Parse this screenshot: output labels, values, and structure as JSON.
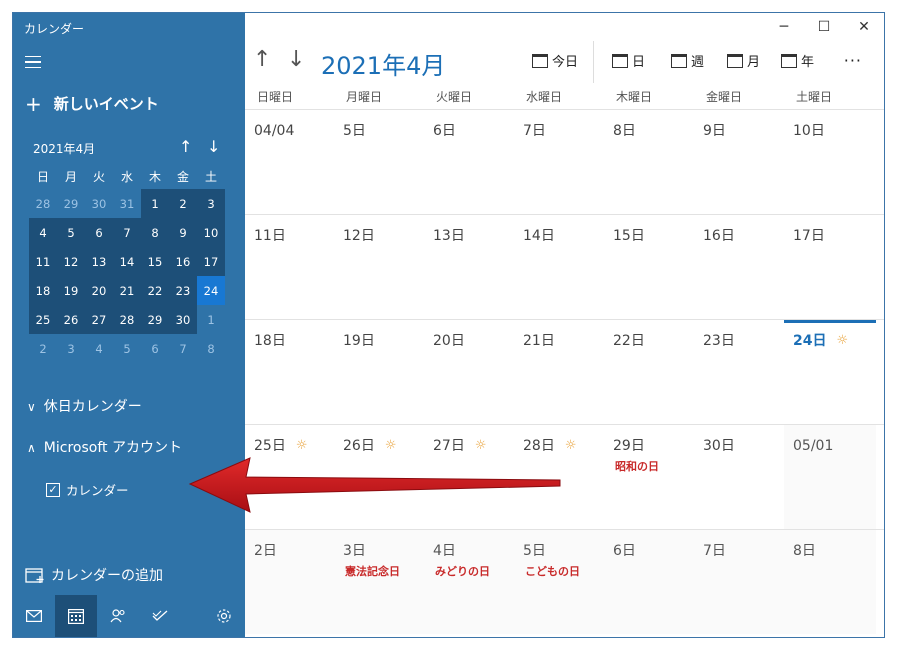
{
  "app": {
    "title": "カレンダー"
  },
  "sidebar": {
    "new_event": "新しいイベント",
    "mini_calendar": {
      "title": "2021年4月",
      "weekdays": [
        "日",
        "月",
        "火",
        "水",
        "木",
        "金",
        "土"
      ],
      "weeks": [
        [
          "28",
          "29",
          "30",
          "31",
          "1",
          "2",
          "3"
        ],
        [
          "4",
          "5",
          "6",
          "7",
          "8",
          "9",
          "10"
        ],
        [
          "11",
          "12",
          "13",
          "14",
          "15",
          "16",
          "17"
        ],
        [
          "18",
          "19",
          "20",
          "21",
          "22",
          "23",
          "24"
        ],
        [
          "25",
          "26",
          "27",
          "28",
          "29",
          "30",
          "1"
        ],
        [
          "2",
          "3",
          "4",
          "5",
          "6",
          "7",
          "8"
        ]
      ],
      "today": "24"
    },
    "holiday_calendar": "休日カレンダー",
    "ms_account": "Microsoft アカウント",
    "calendar_item": "カレンダー",
    "add_calendar": "カレンダーの追加"
  },
  "main": {
    "month_title": "2021年4月",
    "toolbar": {
      "today": "今日",
      "day": "日",
      "week": "週",
      "month": "月",
      "year": "年"
    },
    "weekdays": [
      "日曜日",
      "月曜日",
      "火曜日",
      "水曜日",
      "木曜日",
      "金曜日",
      "土曜日"
    ],
    "weeks": [
      [
        {
          "label": "04/04"
        },
        {
          "label": "5日"
        },
        {
          "label": "6日"
        },
        {
          "label": "7日"
        },
        {
          "label": "8日"
        },
        {
          "label": "9日"
        },
        {
          "label": "10日"
        }
      ],
      [
        {
          "label": "11日"
        },
        {
          "label": "12日"
        },
        {
          "label": "13日"
        },
        {
          "label": "14日"
        },
        {
          "label": "15日"
        },
        {
          "label": "16日"
        },
        {
          "label": "17日"
        }
      ],
      [
        {
          "label": "18日"
        },
        {
          "label": "19日"
        },
        {
          "label": "20日"
        },
        {
          "label": "21日"
        },
        {
          "label": "22日"
        },
        {
          "label": "23日"
        },
        {
          "label": "24日",
          "today": true,
          "sun": true
        }
      ],
      [
        {
          "label": "25日",
          "sun": true
        },
        {
          "label": "26日",
          "sun": true
        },
        {
          "label": "27日",
          "sun": true
        },
        {
          "label": "28日",
          "sun": true
        },
        {
          "label": "29日",
          "holiday": "昭和の日"
        },
        {
          "label": "30日"
        },
        {
          "label": "05/01",
          "out": true
        }
      ],
      [
        {
          "label": "2日",
          "out": true
        },
        {
          "label": "3日",
          "out": true,
          "holiday": "憲法記念日"
        },
        {
          "label": "4日",
          "out": true,
          "holiday": "みどりの日"
        },
        {
          "label": "5日",
          "out": true,
          "holiday": "こどもの日"
        },
        {
          "label": "6日",
          "out": true
        },
        {
          "label": "7日",
          "out": true
        },
        {
          "label": "8日",
          "out": true
        }
      ]
    ]
  },
  "colors": {
    "sidebar": "#2f73a8",
    "accent": "#1c6fb6",
    "holiday": "#c82a2a",
    "arrow": "#c8101a"
  }
}
